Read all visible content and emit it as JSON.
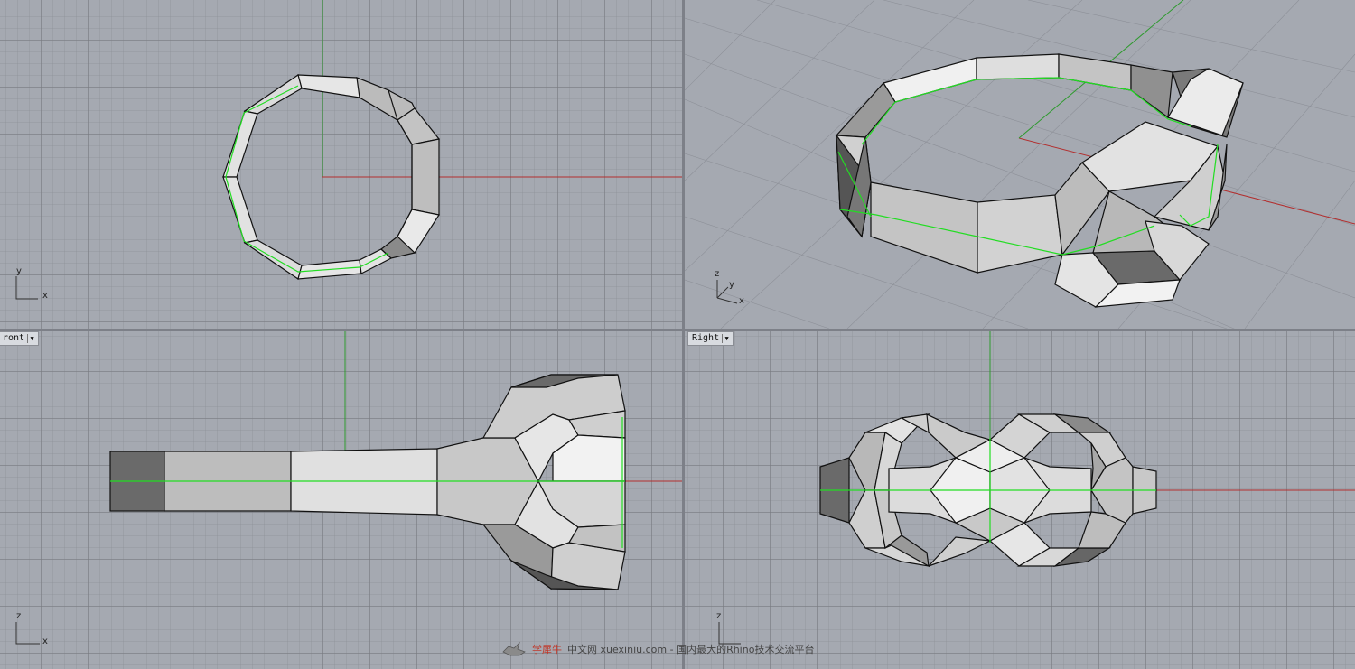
{
  "viewports": {
    "front": {
      "label": "ront"
    },
    "right": {
      "label": "Right"
    }
  },
  "axes": {
    "top": {
      "v": "y",
      "h": "x"
    },
    "persp": {
      "z": "z",
      "y": "y",
      "x": "x"
    },
    "front": {
      "v": "z",
      "h": "x"
    },
    "right": {
      "v": "z"
    }
  },
  "watermark": {
    "brand": "学犀牛",
    "text": "中文网 xuexiniu.com - 国内最大的Rhino技术交流平台"
  },
  "colors": {
    "grid_bg": "#a5a9b1",
    "x_axis": "#b22f2f",
    "y_axis": "#2e9a2e",
    "curve": "#22dd22",
    "face_light": "#e8e8e8",
    "face_mid": "#bdbdbd",
    "face_dark": "#6d6d6d"
  }
}
